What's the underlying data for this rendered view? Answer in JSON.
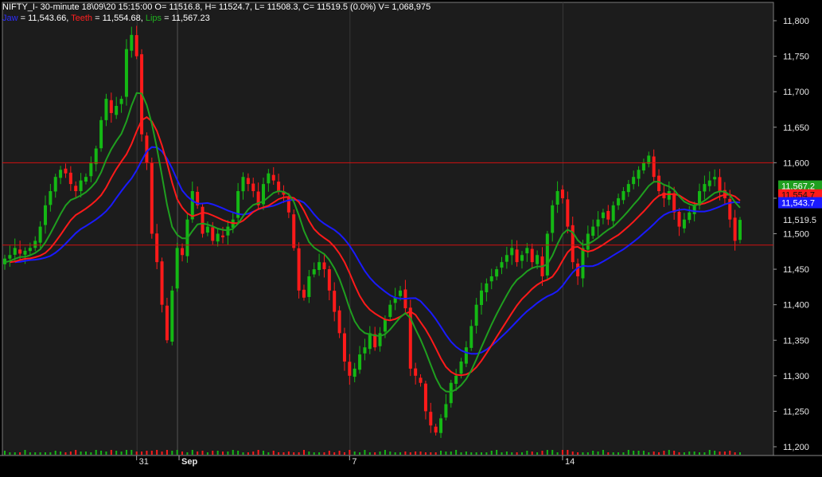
{
  "header": {
    "line1": "NIFTY_I- 30-minute 18\\09\\20 15:15:00 O= 11516.8, H= 11524.7, L= 11508.3, C= 11519.5 (0.0%) V= 1,068,975",
    "jaw_label": "Jaw",
    "jaw_value": " = 11,543.66,",
    "teeth_label": "Teeth",
    "teeth_value": " = 11,554.68,",
    "lips_label": "Lips",
    "lips_value": " = 11,567.23"
  },
  "colors": {
    "background": "#000000",
    "plot_bg": "#1c1c1c",
    "up": "#14b814",
    "down": "#ff1a1a",
    "jaw": "#1a1aff",
    "teeth": "#ff1a1a",
    "lips": "#1f9f1f",
    "hline": "#d01010"
  },
  "chart_data": {
    "type": "candlestick",
    "symbol": "NIFTY_I",
    "interval": "30-minute",
    "y_ticks": [
      "11,800",
      "11,750",
      "11,700",
      "11,650",
      "11,600",
      "11,550",
      "11,500",
      "11,450",
      "11,400",
      "11,350",
      "11,300",
      "11,250",
      "11,200"
    ],
    "ylim": [
      11190,
      11810
    ],
    "x_labels": [
      {
        "label": "31",
        "index": 26
      },
      {
        "label": "Sep",
        "index": 35
      },
      {
        "label": "7",
        "index": 68
      },
      {
        "label": "14",
        "index": 110
      }
    ],
    "horizontal_lines": [
      11600,
      11484
    ],
    "price_tags": [
      {
        "label": "11,567.2",
        "value": 11567.2,
        "color": "#1f9f1f"
      },
      {
        "label": "11,554.7",
        "value": 11554.7,
        "color": "#ff1a1a"
      },
      {
        "label": "11,543.7",
        "value": 11543.7,
        "color": "#1a1aff"
      },
      {
        "label": "11,519.5",
        "value": 11519.5,
        "color": "plain"
      }
    ],
    "closes": [
      11465,
      11470,
      11480,
      11472,
      11476,
      11480,
      11490,
      11510,
      11540,
      11560,
      11580,
      11590,
      11585,
      11570,
      11560,
      11575,
      11580,
      11600,
      11620,
      11660,
      11690,
      11670,
      11680,
      11690,
      11760,
      11780,
      11750,
      11640,
      11600,
      11500,
      11460,
      11400,
      11350,
      11420,
      11480,
      11470,
      11520,
      11560,
      11540,
      11500,
      11510,
      11490,
      11500,
      11495,
      11510,
      11520,
      11560,
      11580,
      11570,
      11560,
      11540,
      11570,
      11585,
      11575,
      11560,
      11555,
      11530,
      11480,
      11420,
      11410,
      11440,
      11450,
      11460,
      11450,
      11420,
      11390,
      11360,
      11320,
      11300,
      11310,
      11330,
      11340,
      11360,
      11340,
      11360,
      11380,
      11400,
      11410,
      11420,
      11395,
      11310,
      11300,
      11290,
      11250,
      11230,
      11220,
      11240,
      11260,
      11290,
      11300,
      11320,
      11340,
      11370,
      11400,
      11420,
      11430,
      11440,
      11450,
      11460,
      11470,
      11480,
      11460,
      11470,
      11480,
      11460,
      11470,
      11440,
      11500,
      11540,
      11560,
      11550,
      11510,
      11460,
      11440,
      11480,
      11500,
      11510,
      11520,
      11530,
      11520,
      11540,
      11550,
      11560,
      11570,
      11580,
      11590,
      11600,
      11610,
      11580,
      11560,
      11550,
      11560,
      11530,
      11510,
      11520,
      11530,
      11540,
      11560,
      11570,
      11575,
      11580,
      11560,
      11550,
      11520,
      11490,
      11519.5
    ],
    "volume_max": 3000000,
    "last_volume": 1068975
  }
}
